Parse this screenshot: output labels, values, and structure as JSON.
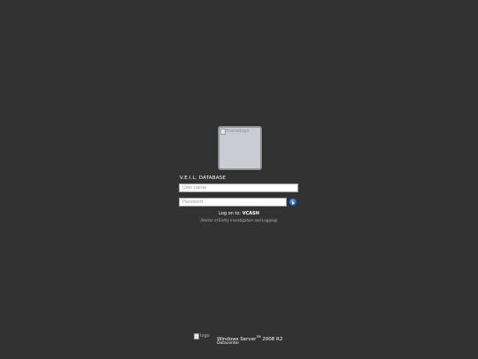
{
  "user_tile": {
    "image_alt": "framelogo"
  },
  "login": {
    "username_label": "V.E.I.L. DATABASE",
    "username_placeholder": "User name",
    "password_placeholder": "Password",
    "submit_icon": "arrow-right-icon",
    "logon_prefix": "Log on to:",
    "logon_domain": "VCASH",
    "domain_subtitle": "(Vector of Entity Investigation and Logging)"
  },
  "branding": {
    "logo_alt": "logo",
    "product_name": "Windows Server",
    "product_mark": "TM",
    "product_version": "2008 R2",
    "edition": "Datacenter"
  },
  "colors": {
    "background": "#323232",
    "submit_accent": "#1f5fb0"
  }
}
